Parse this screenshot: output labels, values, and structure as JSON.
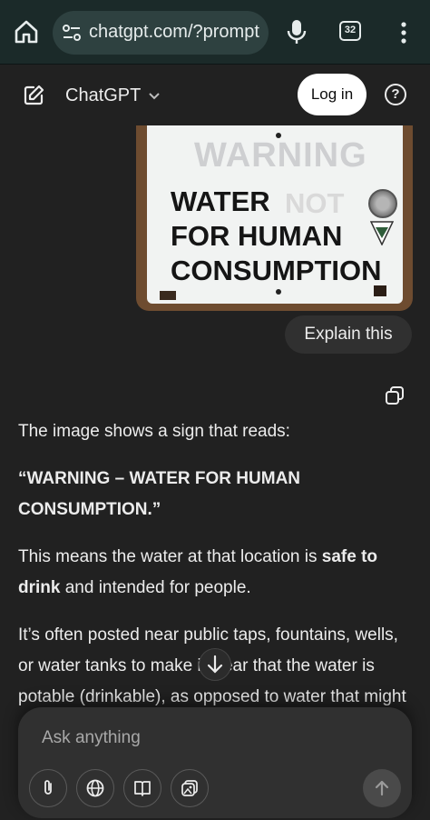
{
  "browser": {
    "url": "chatgpt.com/?prompt",
    "tab_count": "32"
  },
  "header": {
    "model_name": "ChatGPT",
    "login_label": "Log in",
    "help_glyph": "?"
  },
  "image": {
    "sign_faded": "WARNING",
    "sign_lines": [
      "WATER",
      "FOR HUMAN",
      "CONSUMPTION"
    ],
    "sign_not": "NOT"
  },
  "user_message": "Explain this",
  "answer": {
    "intro": "The image shows a sign that reads:",
    "quote": "“WARNING – WATER FOR HUMAN CONSUMPTION.”",
    "p2_start": "This means the water at that location is ",
    "p2_bold1": "safe to drink",
    "p2_end": " and intended for people.",
    "p3": "It’s often posted near public taps, fountains, wells, or water tanks to make it clear that the water is potable (drinkable), as opposed to water that might"
  },
  "composer": {
    "placeholder": "Ask anything"
  },
  "icons": {
    "home": "home-icon",
    "tune": "site-settings-icon",
    "mic": "mic-icon",
    "more": "more-vert-icon",
    "new_chat": "new-chat-icon",
    "copy": "copy-icon",
    "attach": "paperclip-icon",
    "web": "globe-icon",
    "study": "book-icon",
    "image": "image-gen-icon",
    "send": "arrow-up-icon",
    "scroll": "arrow-down-icon"
  },
  "colors": {
    "background": "#212121",
    "browser_bar": "#1b2a29",
    "bubble": "#303030",
    "login_bg": "#ffffff"
  }
}
